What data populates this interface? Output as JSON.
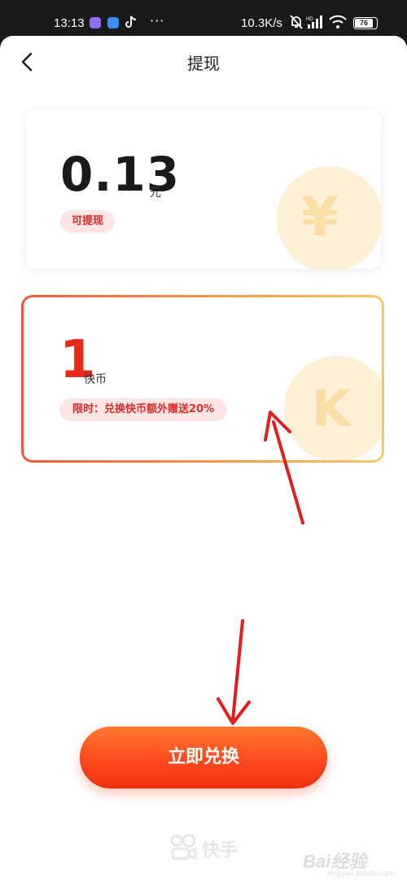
{
  "status_bar": {
    "time": "13:13",
    "more": "···",
    "network_speed": "10.3K/s",
    "battery": "76",
    "icons": [
      "app-notification-icon-1",
      "app-notification-icon-2",
      "tiktok-icon",
      "mute-bell-icon",
      "hd-signal-icon",
      "signal-icon",
      "wifi-icon",
      "battery-icon"
    ]
  },
  "header": {
    "title": "提现",
    "back_icon": "chevron-left-icon"
  },
  "balance_card": {
    "amount": "0.13",
    "unit": "元",
    "tag": "可提现",
    "coin_symbol": "¥"
  },
  "coin_card": {
    "amount": "1",
    "unit": "快币",
    "tag": "限时：兑换快币额外赠送20%",
    "coin_symbol": "K",
    "selected": true,
    "border_gradient": [
      "#ee5a3c",
      "#f4c96a"
    ]
  },
  "action": {
    "exchange_label": "立即兑换"
  },
  "footer": {
    "brand": "快手",
    "watermark": "Bai经验",
    "watermark_url": "jingyan.baidu.com"
  },
  "colors": {
    "accent": "#ff4a20",
    "price_red": "#e52a18",
    "tag_bg": "#fde6e3",
    "coin_bg": "#fdf0d6",
    "annotation_arrow": "#e02020"
  }
}
